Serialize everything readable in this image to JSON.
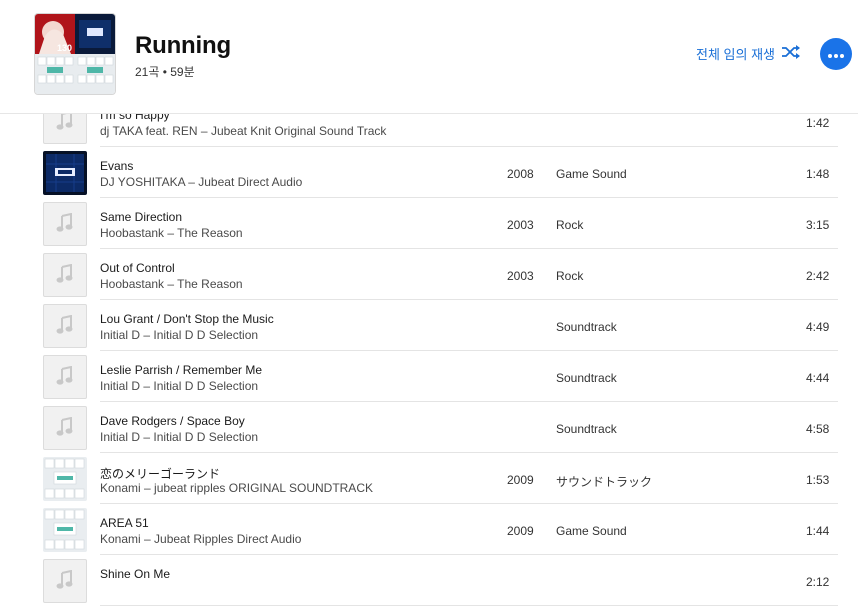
{
  "playlist": {
    "title": "Running",
    "summary": "21곡 • 59분",
    "shuffle_label": "전체 임의 재생",
    "accent": "#1a73e8"
  },
  "tracks": [
    {
      "title": "I'm so Happy",
      "artist_album": "dj TAKA feat. REN – Jubeat Knit Original Sound Track",
      "year": "",
      "genre": "",
      "duration": "1:42",
      "art": "placeholder"
    },
    {
      "title": "Evans",
      "artist_album": "DJ YOSHITAKA – Jubeat Direct Audio",
      "year": "2008",
      "genre": "Game Sound",
      "duration": "1:48",
      "art": "jubeat-dark"
    },
    {
      "title": "Same Direction",
      "artist_album": "Hoobastank – The Reason",
      "year": "2003",
      "genre": "Rock",
      "duration": "3:15",
      "art": "placeholder"
    },
    {
      "title": "Out of Control",
      "artist_album": "Hoobastank – The Reason",
      "year": "2003",
      "genre": "Rock",
      "duration": "2:42",
      "art": "placeholder"
    },
    {
      "title": "Lou Grant / Don't Stop the Music",
      "artist_album": "Initial D – Initial D D Selection",
      "year": "",
      "genre": "Soundtrack",
      "duration": "4:49",
      "art": "placeholder"
    },
    {
      "title": "Leslie Parrish / Remember Me",
      "artist_album": "Initial D – Initial D D Selection",
      "year": "",
      "genre": "Soundtrack",
      "duration": "4:44",
      "art": "placeholder"
    },
    {
      "title": "Dave Rodgers / Space Boy",
      "artist_album": "Initial D – Initial D D Selection",
      "year": "",
      "genre": "Soundtrack",
      "duration": "4:58",
      "art": "placeholder"
    },
    {
      "title": "恋のメリーゴーランド",
      "artist_album": "Konami – jubeat ripples ORIGINAL SOUNDTRACK",
      "year": "2009",
      "genre": "サウンドトラック",
      "duration": "1:53",
      "art": "jubeat-light"
    },
    {
      "title": "AREA 51",
      "artist_album": "Konami – Jubeat Ripples Direct Audio",
      "year": "2009",
      "genre": "Game Sound",
      "duration": "1:44",
      "art": "jubeat-light"
    },
    {
      "title": "Shine On Me",
      "artist_album": "",
      "year": "",
      "genre": "",
      "duration": "2:12",
      "art": "placeholder"
    }
  ]
}
